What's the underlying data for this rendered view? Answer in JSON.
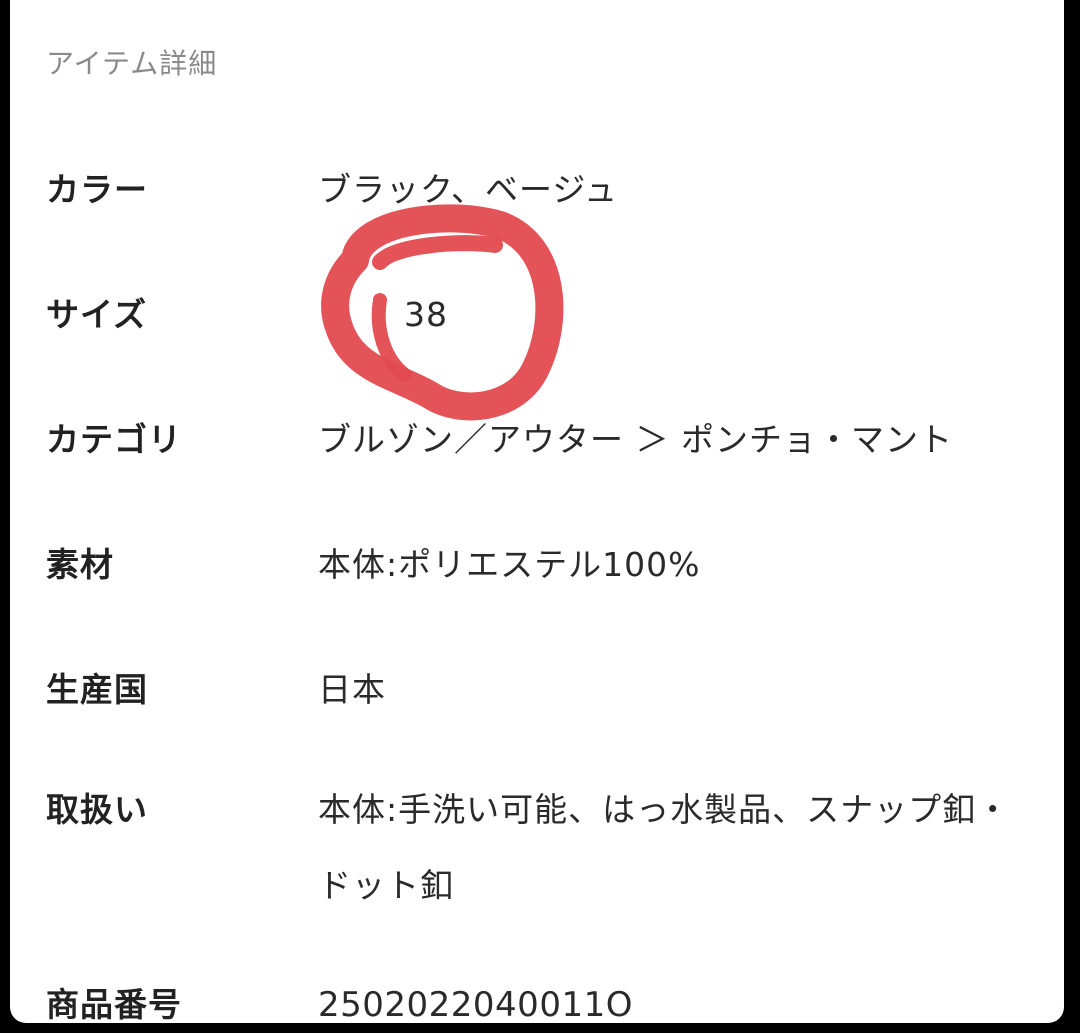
{
  "section": {
    "title": "アイテム詳細"
  },
  "details": {
    "color_label": "カラー",
    "color_value": "ブラック、ベージュ",
    "size_label": "サイズ",
    "size_value": "38",
    "category_label": "カテゴリ",
    "category_value": "ブルゾン／アウター ＞ ポンチョ・マント",
    "material_label": "素材",
    "material_value": "本体:ポリエステル100%",
    "country_label": "生産国",
    "country_value": "日本",
    "care_label": "取扱い",
    "care_value": "本体:手洗い可能、はっ水製品、スナップ釦・ドット釦",
    "code_label": "商品番号",
    "code_value": "2502022040011O"
  },
  "annotation": {
    "color": "#e24a4f",
    "type": "hand-drawn circle around size value"
  }
}
